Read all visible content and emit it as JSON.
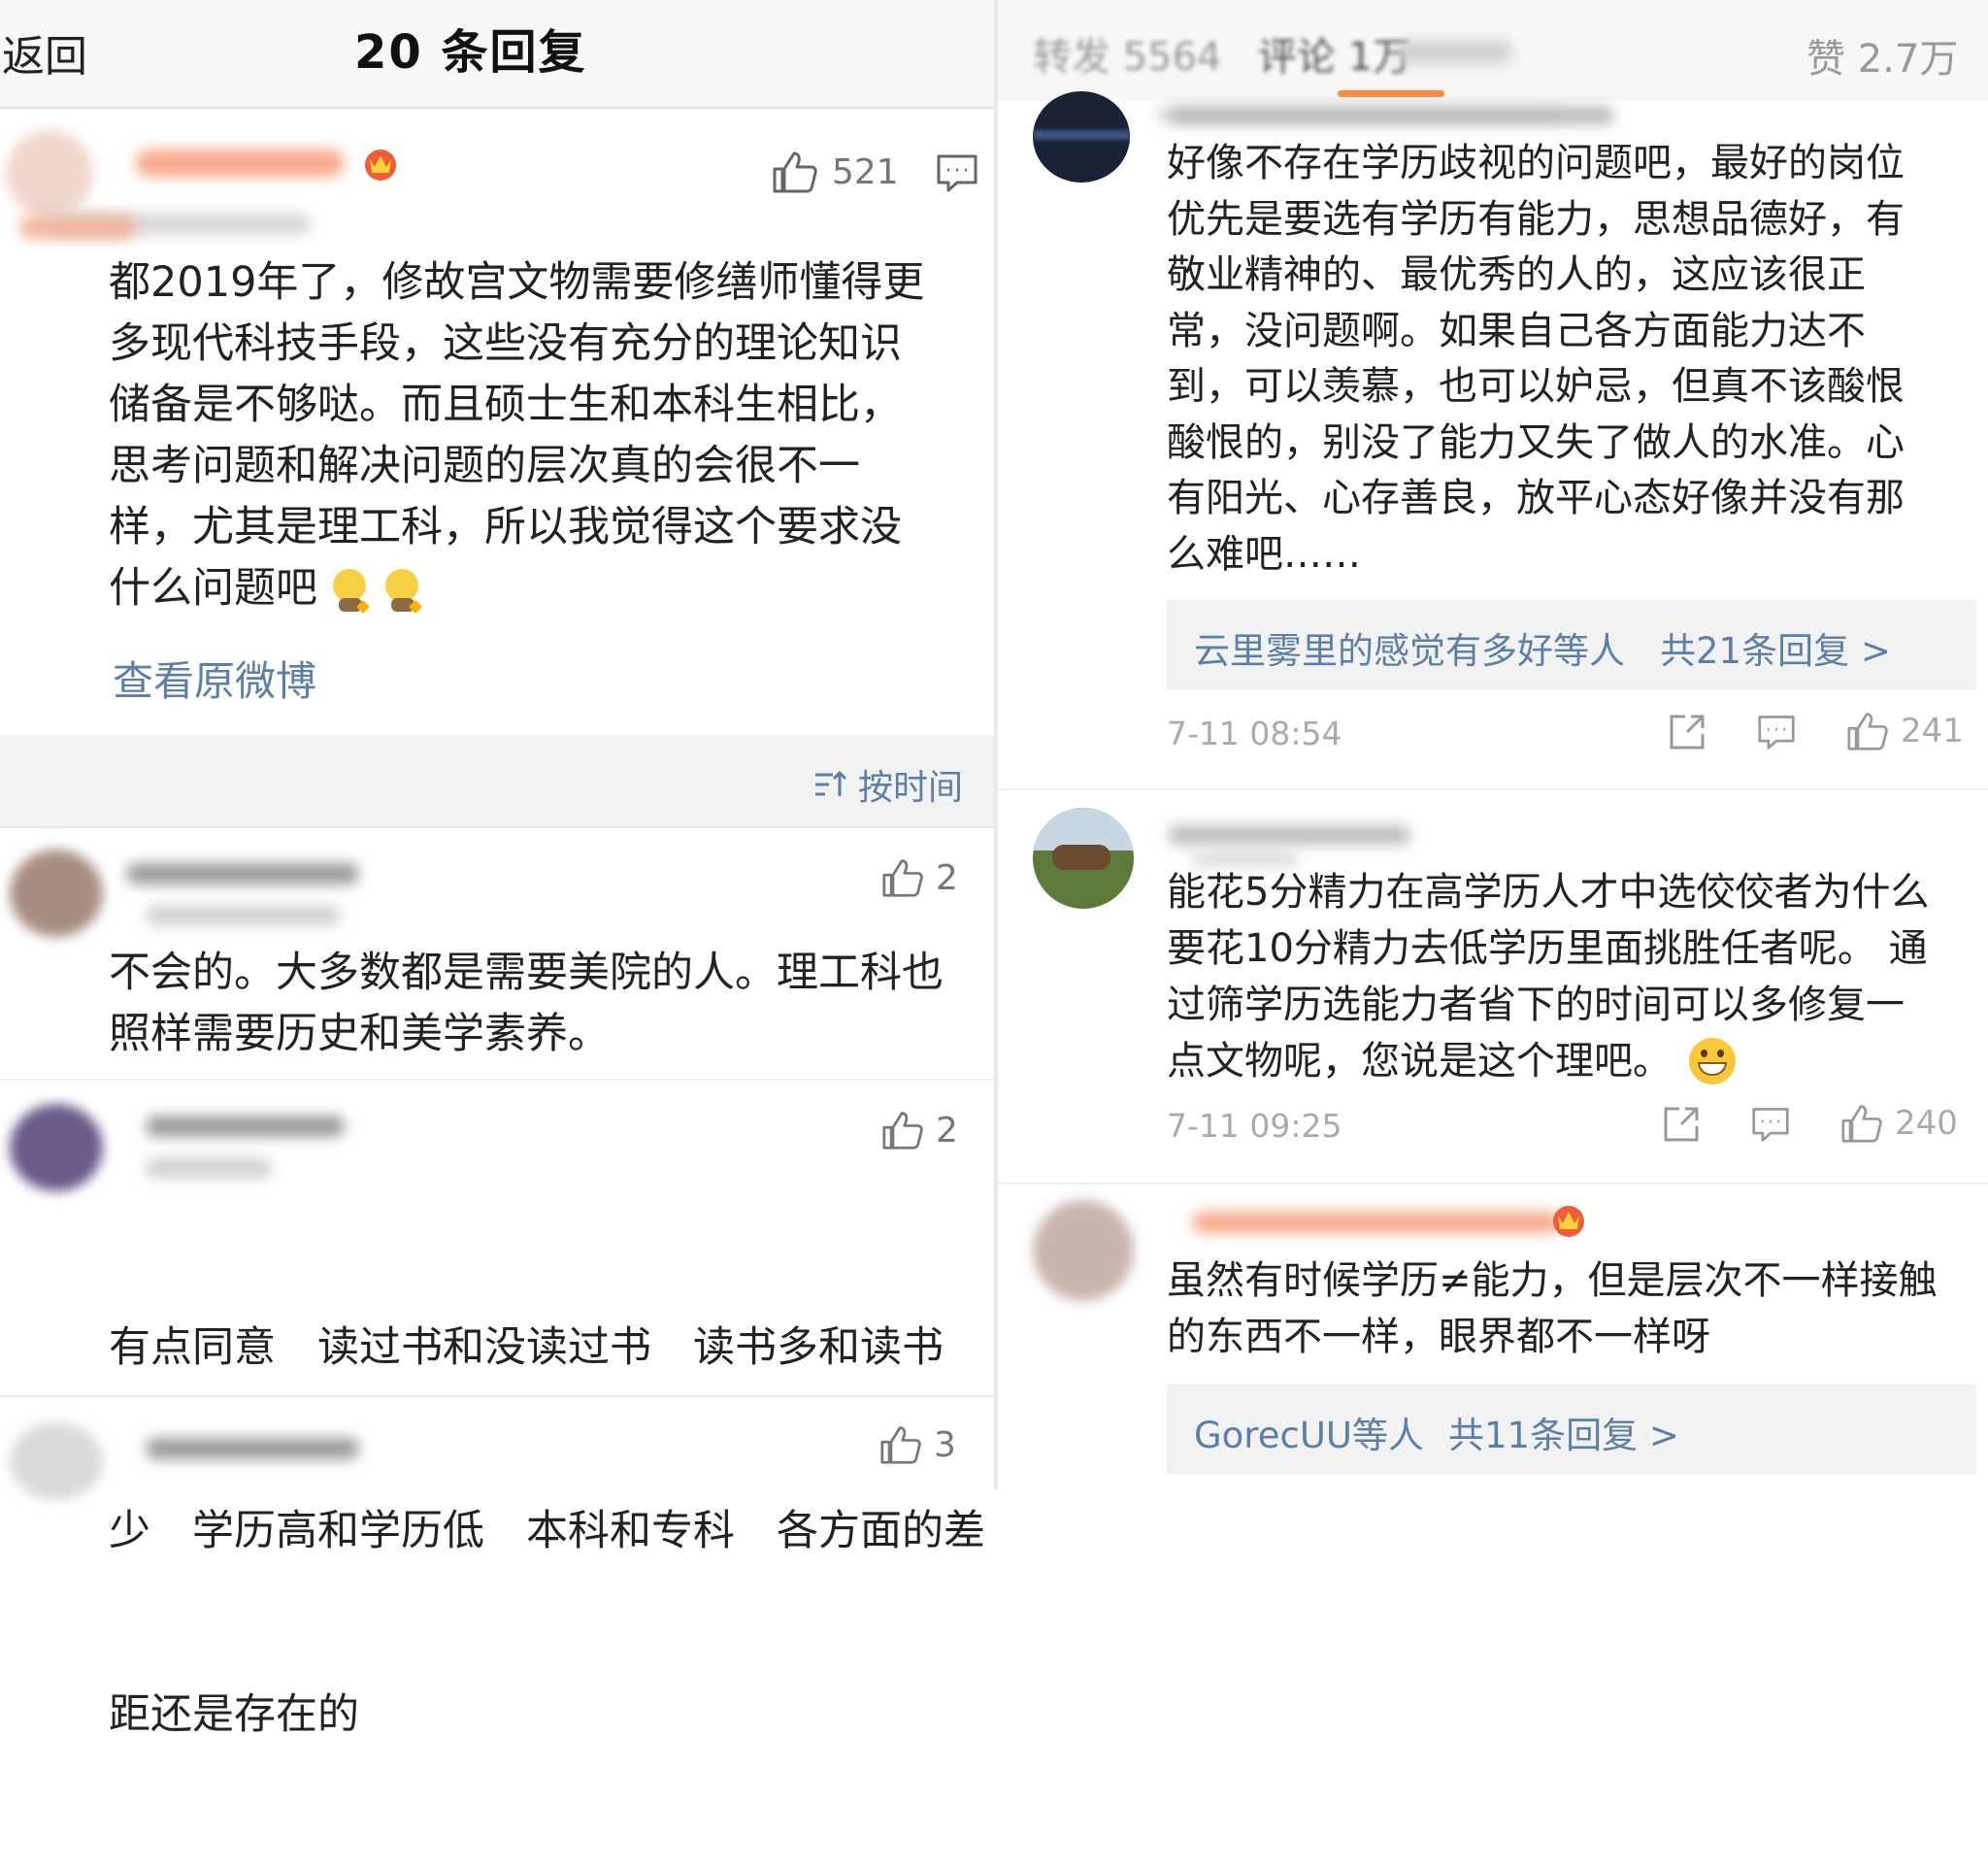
{
  "left": {
    "header": {
      "back_label": "返回",
      "title": "20 条回复"
    },
    "main_comment": {
      "likes": "521",
      "lines": [
        "都2019年了，修故宫文物需要修缮师懂得更",
        "多现代科技手段，这些没有充分的理论知识",
        "储备是不够哒。而且硕士生和本科生相比，",
        "思考问题和解决问题的层次真的会很不一",
        "样，尤其是理工科，所以我觉得这个要求没",
        "什么问题吧"
      ],
      "view_original": "查看原微博"
    },
    "sort_label": "按时间",
    "replies": [
      {
        "likes": "2",
        "lines": [
          "不会的。大多数都是需要美院的人。理工科也",
          "照样需要历史和美学素养。"
        ]
      },
      {
        "likes": "2",
        "lines": [
          "有点同意　读过书和没读过书　读书多和读书",
          "少　学历高和学历低　本科和专科　各方面的差",
          "距还是存在的"
        ]
      },
      {
        "likes": "3"
      }
    ]
  },
  "right": {
    "top_bar": {
      "reposts": "转发 5564",
      "comments": "评论 1万",
      "likes": "赞 2.7万"
    },
    "comments": [
      {
        "lines": [
          "好像不存在学历歧视的问题吧，最好的岗位",
          "优先是要选有学历有能力，思想品德好，有",
          "敬业精神的、最优秀的人的，这应该很正",
          "常，没问题啊。如果自己各方面能力达不",
          "到，可以羡慕，也可以妒忌，但真不该酸恨",
          "酸恨的，别没了能力又失了做人的水准。心",
          "有阳光、心存善良，放平心态好像并没有那",
          "么难吧……"
        ],
        "reply_users": "云里雾里的感觉有多好等人",
        "reply_count": "共21条回复 >",
        "time": "7-11 08:54",
        "likes": "241"
      },
      {
        "lines": [
          "能花5分精力在高学历人才中选佼佼者为什么",
          "要花10分精力去低学历里面挑胜任者呢。 通",
          "过筛学历选能力者省下的时间可以多修复一",
          "点文物呢，您说是这个理吧。"
        ],
        "time": "7-11 09:25",
        "likes": "240"
      },
      {
        "lines": [
          "虽然有时候学历≠能力，但是层次不一样接触",
          "的东西不一样，眼界都不一样呀"
        ],
        "reply_users": "GorecUU等人",
        "reply_count": "共11条回复 >"
      }
    ]
  },
  "icons": [
    "thumbs-up-icon",
    "comment-icon",
    "share-icon",
    "sort-icon",
    "crown-badge-icon",
    "grin-emoji-icon",
    "smile-emoji-icon"
  ],
  "colors": {
    "link": "#5b7fa6",
    "orange_accent": "#ff8a3d",
    "divider": "#e2e2e2",
    "section_bg": "#f2f2f2"
  }
}
